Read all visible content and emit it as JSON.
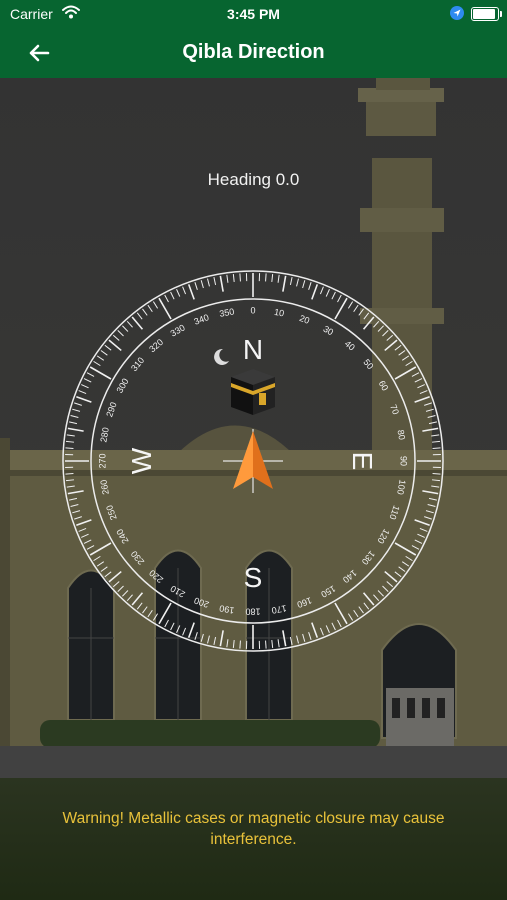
{
  "status_bar": {
    "carrier": "Carrier",
    "time": "3:45 PM",
    "wifi_icon": "wifi-icon",
    "location_icon": "location-arrow-icon",
    "battery_icon": "battery-full-icon"
  },
  "nav": {
    "title": "Qibla Direction",
    "back_icon": "arrow-left-icon"
  },
  "heading": {
    "text": "Heading 0.0"
  },
  "compass": {
    "cardinals": [
      "N",
      "E",
      "S",
      "W"
    ],
    "degree_labels": [
      "0",
      "10",
      "20",
      "30",
      "40",
      "50",
      "60",
      "70",
      "80",
      "90",
      "100",
      "110",
      "120",
      "130",
      "140",
      "150",
      "160",
      "170",
      "180",
      "190",
      "200",
      "210",
      "220",
      "230",
      "240",
      "250",
      "260",
      "270",
      "280",
      "290",
      "300",
      "310",
      "320",
      "330",
      "340",
      "350"
    ],
    "qibla_icon": "kaaba-icon",
    "pointer_icon": "navigation-arrow-icon"
  },
  "warning": {
    "text": "Warning! Metallic cases or magnetic closure may cause interference."
  },
  "colors": {
    "header": "#076530",
    "warning": "#e9c23a",
    "arrow": "#f08a24"
  }
}
